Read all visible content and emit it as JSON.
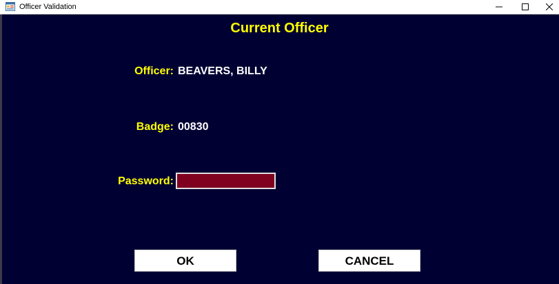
{
  "window": {
    "title": "Officer Validation",
    "app_icon": "form-window-icon",
    "controls": {
      "minimize_icon": "minimize-icon",
      "maximize_icon": "maximize-icon",
      "close_icon": "close-icon"
    }
  },
  "form": {
    "heading": "Current Officer",
    "officer_label": "Officer:",
    "officer_value": "BEAVERS, BILLY",
    "badge_label": "Badge:",
    "badge_value": "00830",
    "password_label": "Password:",
    "password_value": ""
  },
  "buttons": {
    "ok_label": "OK",
    "cancel_label": "CANCEL"
  },
  "colors": {
    "background": "#000033",
    "label": "#ffff00",
    "value": "#ffffff",
    "password_field": "#800020",
    "button": "#ffffff"
  }
}
